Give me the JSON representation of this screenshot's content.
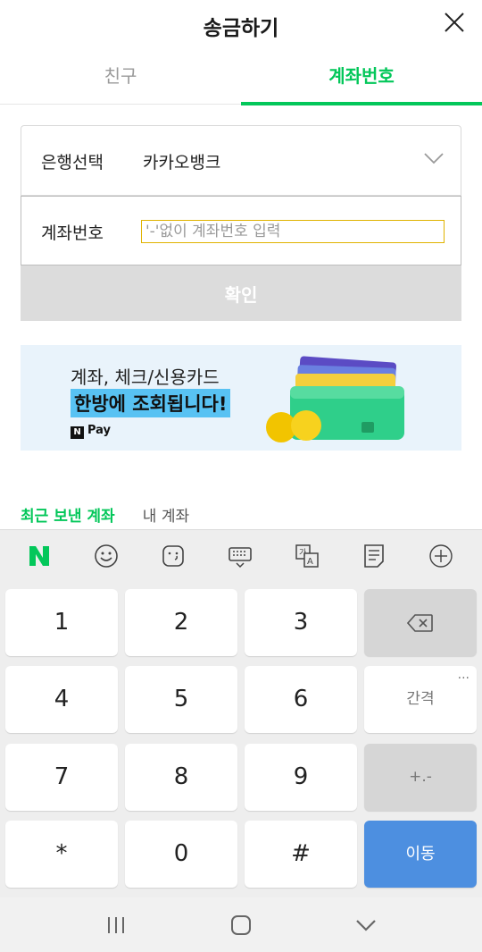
{
  "header": {
    "title": "송금하기"
  },
  "tabs": [
    {
      "label": "친구"
    },
    {
      "label": "계좌번호"
    }
  ],
  "form": {
    "bank_label": "은행선택",
    "bank_value": "카카오뱅크",
    "account_label": "계좌번호",
    "account_placeholder": "'-'없이 계좌번호 입력",
    "account_value": "",
    "confirm_label": "확인"
  },
  "banner": {
    "line1": "계좌, 체크/신용카드",
    "line2": "한방에 조회됩니다!",
    "brand": "Pay",
    "brand_mark": "N"
  },
  "recent_tabs": [
    {
      "label": "최근 보낸 계좌"
    },
    {
      "label": "내 계좌"
    }
  ],
  "keyboard": {
    "toolbar": [
      "naver-logo-icon",
      "emoji-icon",
      "sticker-icon",
      "keyboard-icon",
      "translate-icon",
      "memo-icon",
      "plus-icon"
    ],
    "keys": {
      "k1": "1",
      "k2": "2",
      "k3": "3",
      "k4": "4",
      "k5": "5",
      "k6": "6",
      "k7": "7",
      "k8": "8",
      "k9": "9",
      "kstar": "*",
      "k0": "0",
      "khash": "#",
      "space": "간격",
      "symbols": "+.-",
      "go": "이동",
      "more": "..."
    }
  },
  "colors": {
    "accent": "#03c75a",
    "go_key": "#4d8fe0",
    "input_border": "#e0b300"
  }
}
